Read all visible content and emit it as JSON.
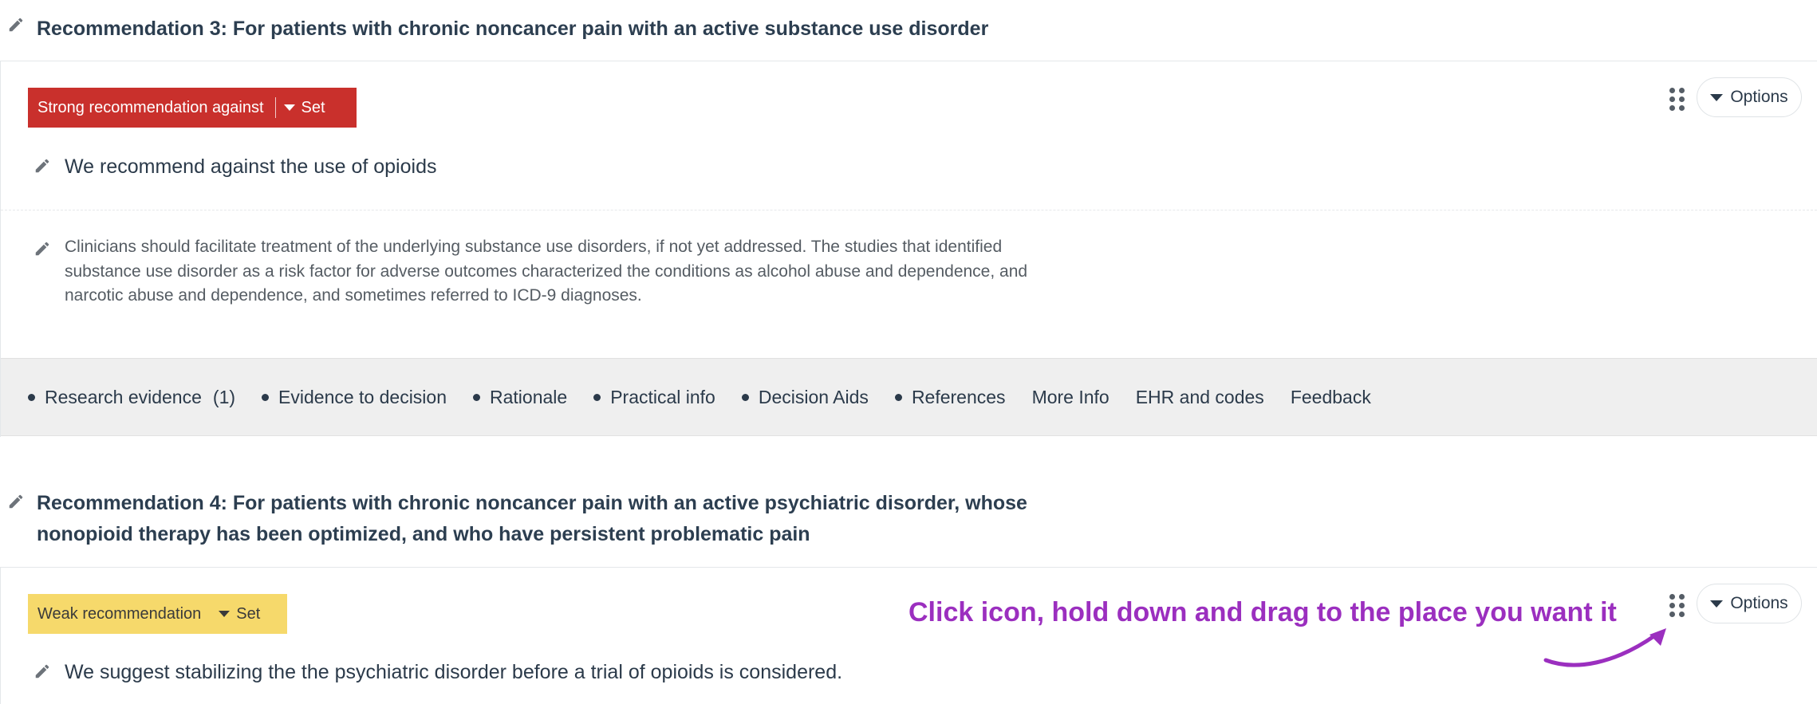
{
  "section3": {
    "heading": "Recommendation 3: For patients with chronic noncancer pain with an active substance use disorder",
    "badge_label": "Strong recommendation against",
    "badge_set": "Set",
    "options_label": "Options",
    "recommendation_text": "We recommend against the use of opioids",
    "remark": "Clinicians should facilitate treatment of the underlying substance use disorders, if not yet addressed. The studies that identified substance use disorder as a risk factor for adverse outcomes characterized the conditions as alcohol abuse and dependence, and narcotic abuse and dependence, and sometimes referred to ICD-9 diagnoses.",
    "tabs": [
      {
        "label": "Research evidence",
        "count": "(1)",
        "dot": true
      },
      {
        "label": "Evidence to decision",
        "dot": true
      },
      {
        "label": "Rationale",
        "dot": true
      },
      {
        "label": "Practical info",
        "dot": true
      },
      {
        "label": "Decision Aids",
        "dot": true
      },
      {
        "label": "References",
        "dot": true
      },
      {
        "label": "More Info",
        "dot": false
      },
      {
        "label": "EHR and codes",
        "dot": false
      },
      {
        "label": "Feedback",
        "dot": false
      }
    ]
  },
  "section4": {
    "heading_line1": "Recommendation 4: For patients with chronic noncancer pain with an active psychiatric disorder, whose",
    "heading_line2": "nonopioid therapy has been optimized, and who have persistent problematic pain",
    "badge_label": "Weak recommendation",
    "badge_set": "Set",
    "options_label": "Options",
    "recommendation_text": "We suggest stabilizing the the psychiatric disorder before a trial of opioids is considered."
  },
  "annotation": {
    "hint_text": "Click icon, hold down and drag to the place you want it"
  },
  "colors": {
    "strong_badge": "#c9302c",
    "weak_badge": "#f6d96b",
    "hint": "#9b2fbf",
    "tabs_bar": "#efefef"
  },
  "icons": [
    "pencil-icon",
    "drag-handle-icon",
    "caret-down-icon",
    "arrow-annotation"
  ]
}
